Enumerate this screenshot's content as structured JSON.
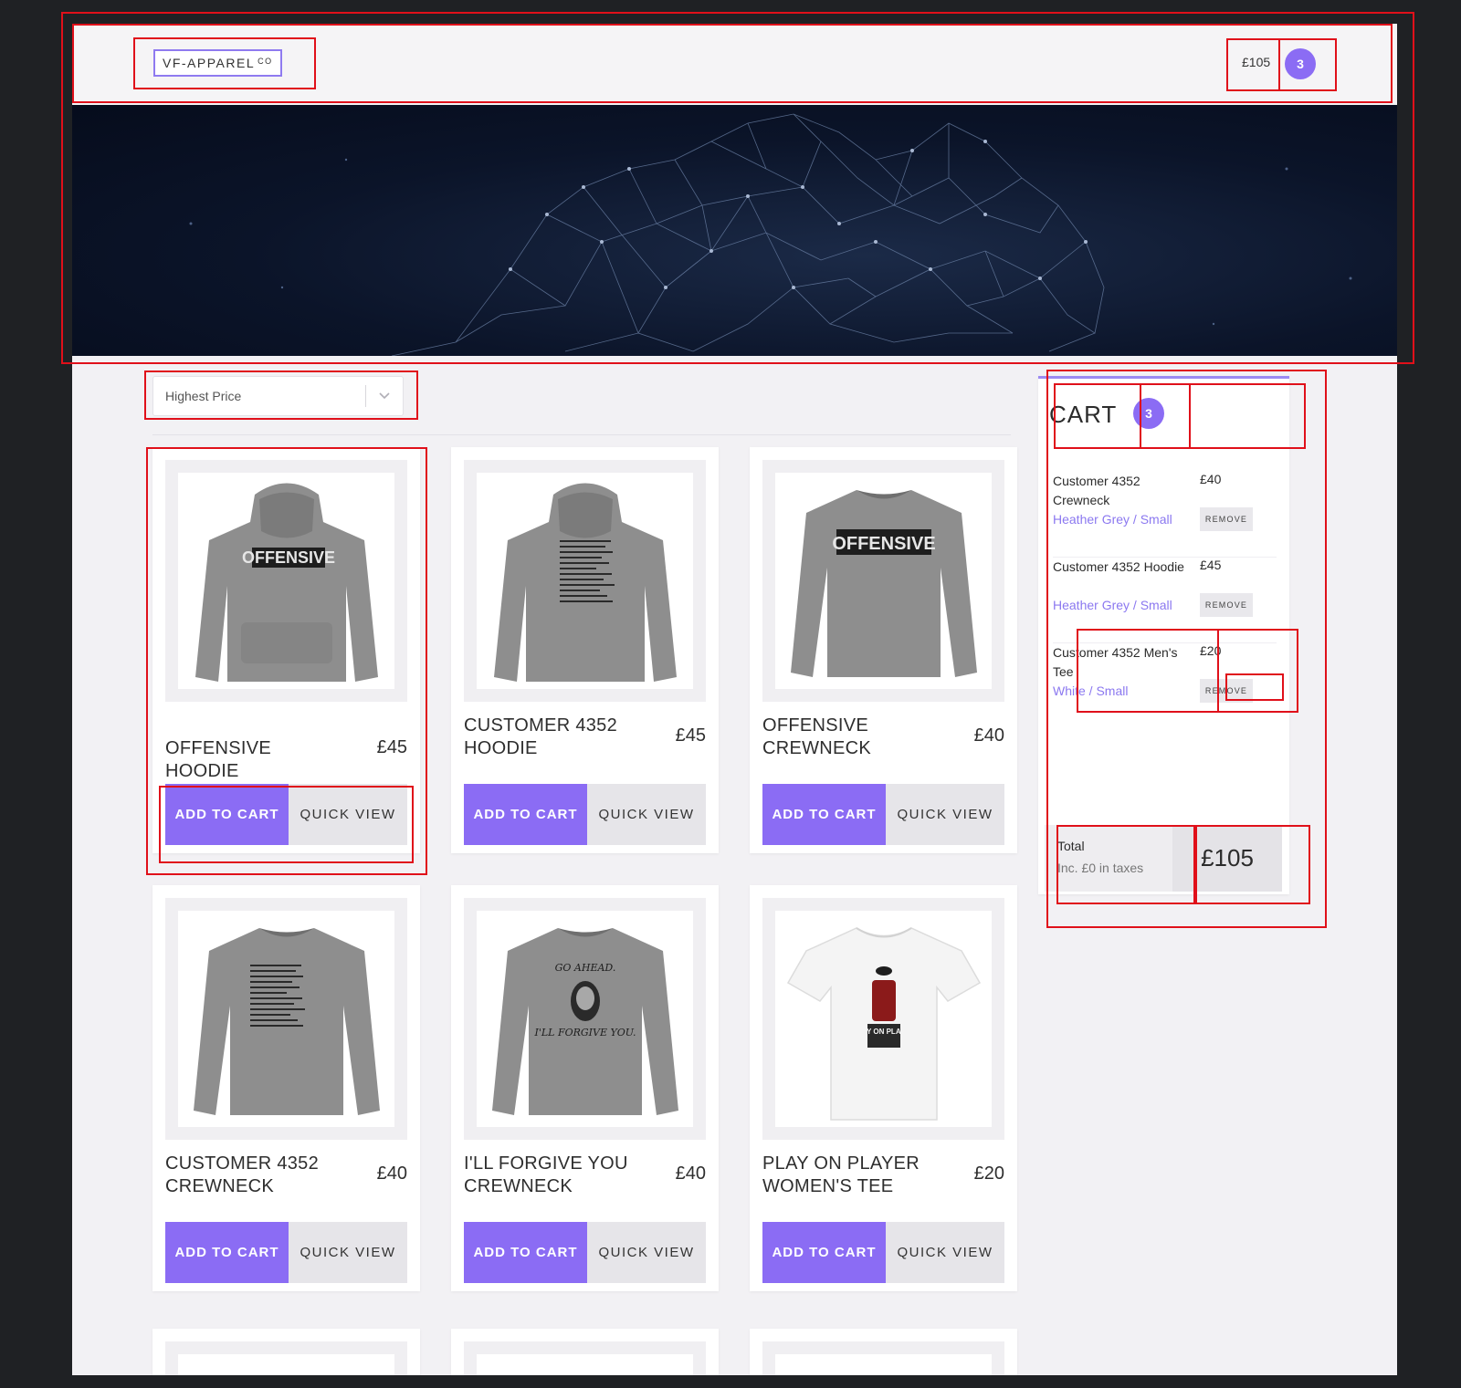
{
  "header": {
    "logo_text": "VF-APPAREL",
    "logo_sup": "CO",
    "cart_total": "£105",
    "cart_count": "3"
  },
  "sort": {
    "selected": "Highest Price"
  },
  "products": [
    {
      "title": "OFFENSIVE HOODIE",
      "price": "£45",
      "add_label": "ADD TO CART",
      "quick_label": "QUICK VIEW",
      "print": "OFFENSIVE"
    },
    {
      "title": "CUSTOMER 4352 HOODIE",
      "price": "£45",
      "add_label": "ADD TO CART",
      "quick_label": "QUICK VIEW"
    },
    {
      "title": "OFFENSIVE CREWNECK",
      "price": "£40",
      "add_label": "ADD TO CART",
      "quick_label": "QUICK VIEW",
      "print": "OFFENSIVE"
    },
    {
      "title": "CUSTOMER 4352 CREWNECK",
      "price": "£40",
      "add_label": "ADD TO CART",
      "quick_label": "QUICK VIEW"
    },
    {
      "title": "I'LL FORGIVE YOU CREWNECK",
      "price": "£40",
      "add_label": "ADD TO CART",
      "quick_label": "QUICK VIEW",
      "print_top": "GO AHEAD.",
      "print_bottom": "I'LL FORGIVE YOU."
    },
    {
      "title": "PLAY ON PLAYER WOMEN'S TEE",
      "price": "£20",
      "add_label": "ADD TO CART",
      "quick_label": "QUICK VIEW",
      "print": "PLAY ON PLAYER"
    }
  ],
  "cart": {
    "title": "CART",
    "count": "3",
    "remove_label": "REMOVE",
    "items": [
      {
        "name": "Customer 4352 Crewneck",
        "price": "£40",
        "variant": "Heather Grey / Small"
      },
      {
        "name": "Customer 4352 Hoodie",
        "price": "£45",
        "variant": "Heather Grey / Small"
      },
      {
        "name": "Customer 4352 Men's Tee",
        "price": "£20",
        "variant": "White / Small"
      }
    ],
    "total_label": "Total",
    "tax_note": "Inc. £0 in taxes",
    "total_value": "£105"
  },
  "colors": {
    "accent": "#8b6cf4",
    "annotation": "#e0101a",
    "background": "#1f2124"
  }
}
